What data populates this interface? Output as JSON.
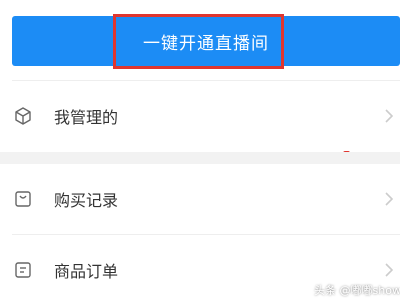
{
  "live_button": {
    "label": "一键开通直播间"
  },
  "menu": {
    "items": [
      {
        "icon": "cube-icon",
        "label": "我管理的"
      },
      {
        "icon": "shopping-bag-icon",
        "label": "购买记录"
      },
      {
        "icon": "order-list-icon",
        "label": "商品订单"
      }
    ]
  },
  "watermark": {
    "text": "头条 @嘟嘟show"
  },
  "colors": {
    "primary_blue": "#1c8cf5",
    "highlight_red": "#e0362f",
    "text": "#333333",
    "chevron": "#cccccc"
  }
}
